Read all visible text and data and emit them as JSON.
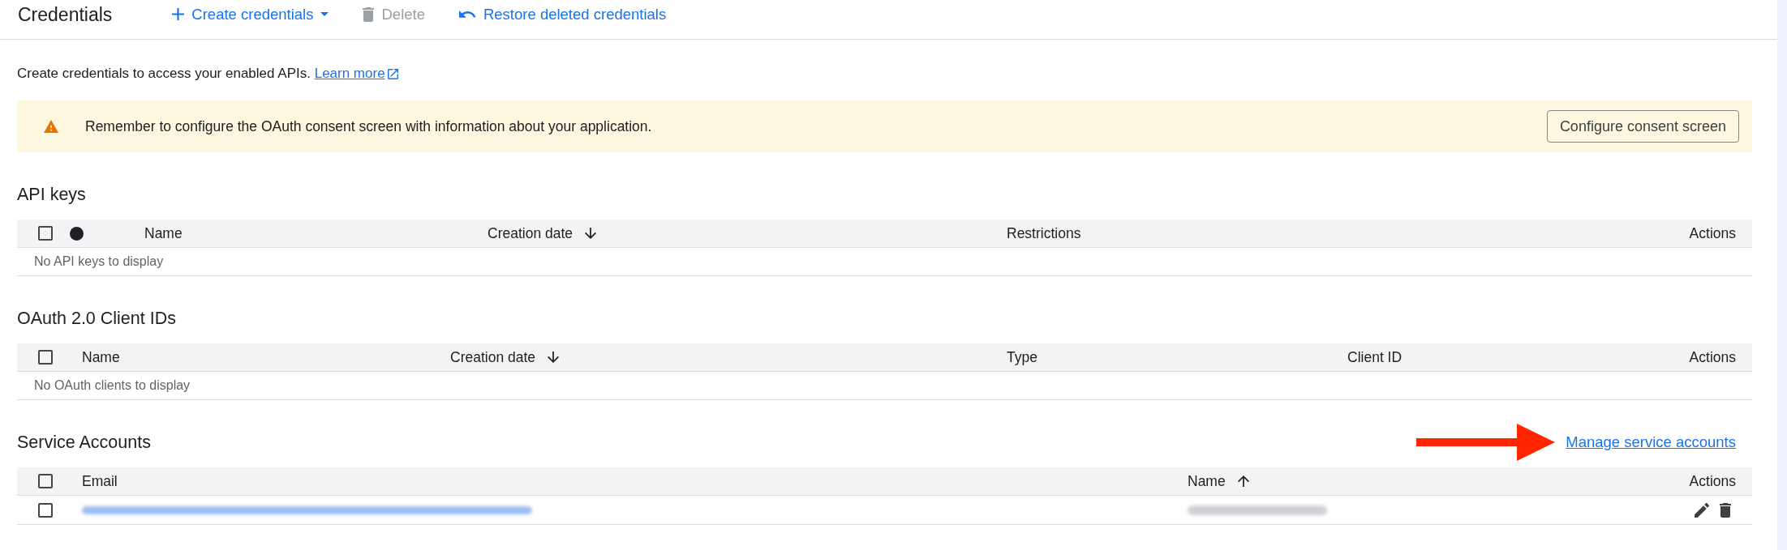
{
  "toolbar": {
    "title": "Credentials",
    "actions": [
      {
        "kind": "create",
        "label": "Create credentials",
        "disabled": false,
        "menu": true
      },
      {
        "kind": "delete",
        "label": "Delete",
        "disabled": true,
        "menu": false
      },
      {
        "kind": "restore",
        "label": "Restore deleted credentials",
        "disabled": false,
        "menu": false
      }
    ]
  },
  "intro": {
    "text": "Create credentials to access your enabled APIs.",
    "link": "Learn more"
  },
  "banner": {
    "kind": "warning",
    "message": "Remember to configure the OAuth consent screen with information about your application.",
    "button": "Configure consent screen"
  },
  "sections": [
    {
      "kind": "api_keys",
      "title": "API keys",
      "columns": [
        {
          "kind": "checkbox",
          "checked": false
        },
        {
          "kind": "status"
        },
        {
          "kind": "text",
          "label": "Name",
          "sorted": false
        },
        {
          "kind": "text",
          "label": "Creation date",
          "sorted": true,
          "ascending": false
        },
        {
          "kind": "text",
          "label": "Restrictions",
          "sorted": false
        },
        {
          "kind": "actions",
          "label": "Actions"
        }
      ],
      "empty_message": "No API keys to display"
    },
    {
      "kind": "oauth_clients",
      "title": "OAuth 2.0 Client IDs",
      "columns": [
        {
          "kind": "checkbox",
          "checked": false
        },
        {
          "kind": "text",
          "label": "Name",
          "sorted": false
        },
        {
          "kind": "text",
          "label": "Creation date",
          "sorted": true,
          "ascending": false
        },
        {
          "kind": "text",
          "label": "Type",
          "sorted": false
        },
        {
          "kind": "text",
          "label": "Client ID",
          "sorted": false
        },
        {
          "kind": "actions",
          "label": "Actions"
        }
      ],
      "empty_message": "No OAuth clients to display"
    },
    {
      "kind": "service_accounts",
      "title": "Service Accounts",
      "annotation": {
        "kind": "arrow"
      },
      "link": "Manage service accounts",
      "columns": [
        {
          "kind": "checkbox",
          "checked": false
        },
        {
          "kind": "text",
          "label": "Email",
          "sorted": false
        },
        {
          "kind": "text",
          "label": "Name",
          "sorted": true,
          "ascending": true
        },
        {
          "kind": "actions",
          "label": "Actions"
        }
      ],
      "rows": [
        {
          "checked": false,
          "cells": [
            {
              "kind": "link",
              "redacted": true
            },
            {
              "kind": "text",
              "redacted": true
            }
          ]
        }
      ]
    }
  ]
}
